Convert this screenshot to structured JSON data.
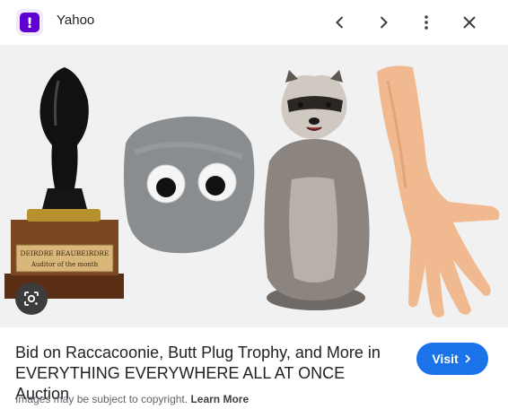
{
  "header": {
    "source_name": "Yahoo",
    "back_icon": "chevron-left-icon",
    "forward_icon": "chevron-right-icon",
    "more_icon": "more-vert-icon",
    "close_icon": "close-icon"
  },
  "image": {
    "plaque_line1": "DEIRDRE BEAUBEIRDRE",
    "plaque_line2": "Auditor of the month",
    "lens_icon": "google-lens-icon"
  },
  "caption": {
    "title_line1": "Bid on Raccacoonie, Butt Plug Trophy, and More in",
    "title_line2": "EVERYTHING EVERYWHERE ALL AT ONCE Auction"
  },
  "visit_label": "Visit",
  "footer": {
    "notice": "Images may be subject to copyright.",
    "learn_more": "Learn More"
  },
  "colors": {
    "brand": "#6001d2",
    "accent": "#1a73e8"
  }
}
